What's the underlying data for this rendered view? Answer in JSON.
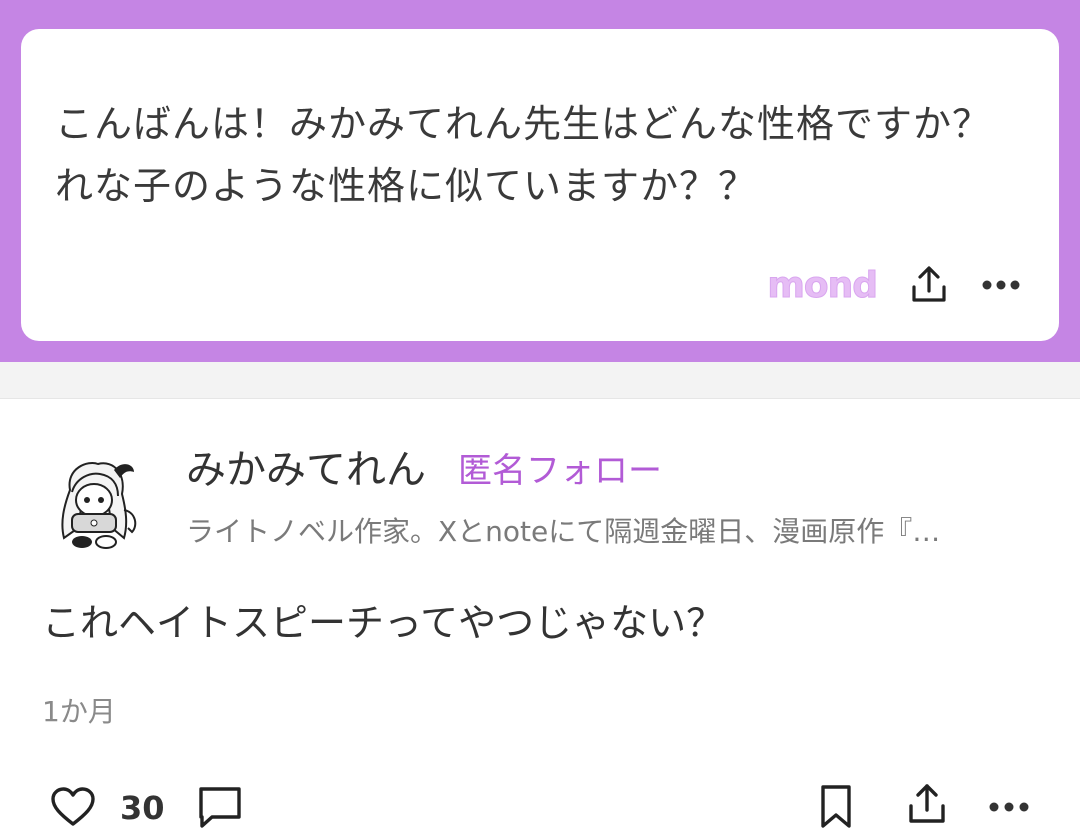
{
  "question": {
    "text": "こんばんは！みかみてれん先生はどんな性格ですか？れな子のような性格に似ていますか？？",
    "logo_text": "mond",
    "share_icon": "share-icon",
    "more_icon": "more-horizontal-icon"
  },
  "answer": {
    "author_name": "みかみてれん",
    "follow_label": "匿名フォロー",
    "author_bio": "ライトノベル作家。Xとnoteにて隔週金曜日、漫画原作『…",
    "text": "これヘイトスピーチってやつじゃない？",
    "timestamp": "1か月"
  },
  "actions": {
    "like_count": "30",
    "like_icon": "heart-icon",
    "comment_icon": "comment-icon",
    "bookmark_icon": "bookmark-icon",
    "share_icon": "share-icon",
    "more_icon": "more-horizontal-icon"
  },
  "colors": {
    "brand_purple": "#c585e4",
    "follow_purple": "#b25bd6",
    "logo_lavender": "#e6bdf5"
  }
}
